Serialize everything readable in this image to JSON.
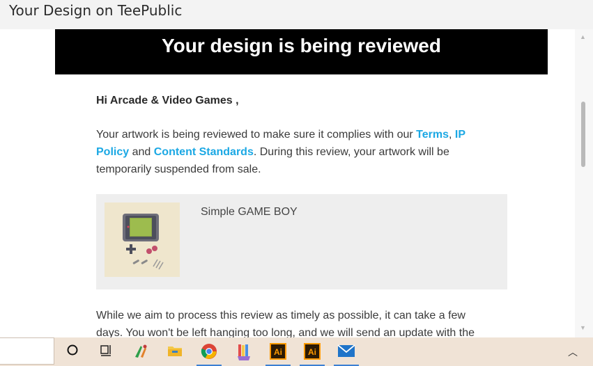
{
  "window": {
    "title": "Your Design on TeePublic"
  },
  "email": {
    "banner_heading": "Your design is being reviewed",
    "greeting": "Hi Arcade & Video Games ,",
    "para1_text1": "Your artwork is being reviewed to make sure it complies with our ",
    "link_terms": "Terms",
    "sep1": ", ",
    "link_ip_policy": "IP Policy",
    "para1_text2": " and ",
    "link_content_standards": "Content Standards",
    "para1_text3": ". During this review, your artwork will be temporarily suspended from sale.",
    "design_name": "Simple GAME BOY",
    "para2": "While we aim to process this review as timely as possible, it can take a few days. You won't be left hanging too long, and we will send an update with the"
  },
  "colors": {
    "link": "#1ba8e4",
    "banner_bg": "#000000",
    "card_bg": "#eeeeee",
    "taskbar_bg": "#f0e3d6"
  },
  "taskbar": {
    "icons": [
      "cortana-icon",
      "task-view-icon",
      "paint-app-icon",
      "file-explorer-icon",
      "chrome-icon",
      "pencils-app-icon",
      "illustrator-icon",
      "illustrator-icon-2",
      "mail-icon"
    ],
    "illustrator_label": "Ai"
  }
}
